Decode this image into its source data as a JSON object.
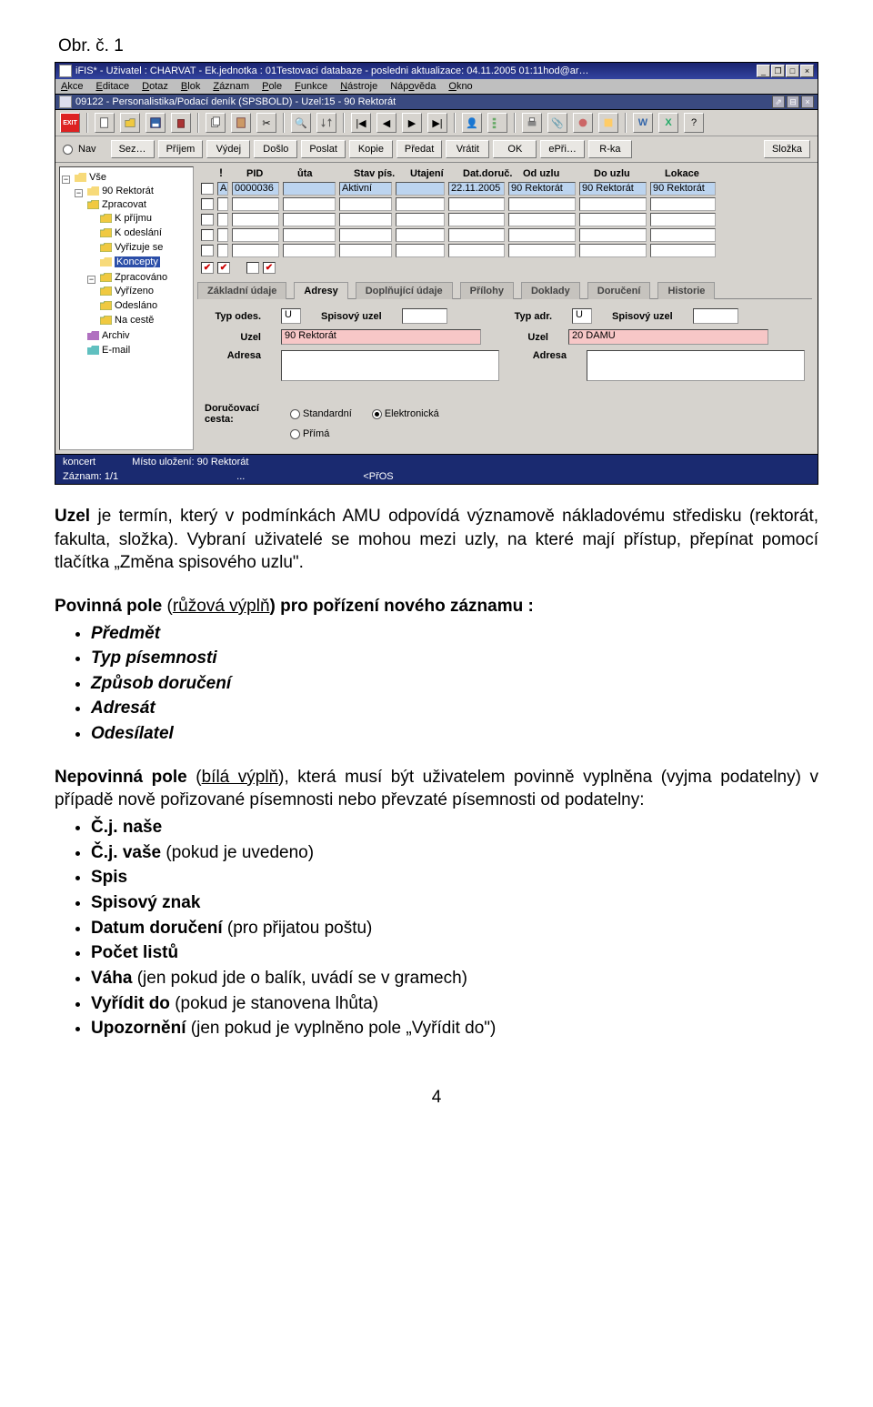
{
  "fig_label": "Obr. č. 1",
  "window": {
    "title": "iFIS* - Uživatel : CHARVAT - Ek.jednotka : 01Testovaci databaze - posledni aktualizace: 04.11.2005 01:11hod@ar…",
    "menu": [
      "Akce",
      "Editace",
      "Dotaz",
      "Blok",
      "Záznam",
      "Pole",
      "Funkce",
      "Nástroje",
      "Nápověda",
      "Okno"
    ],
    "sub_title": "09122 - Personalistika/Podací deník (SPSBOLD) - Uzel:15 - 90 Rektorát",
    "exit_label": "EXIT",
    "filter_nav": "Nav",
    "filter_tabs": [
      "Sez…",
      "Příjem",
      "Výdej",
      "Došlo",
      "Poslat",
      "Kopie",
      "Předat",
      "Vrátit",
      "OK",
      "ePři…",
      "R-ka"
    ],
    "filter_tabs_right": "Složka",
    "grid": {
      "headers": [
        "!",
        "",
        "PID",
        "ůta",
        "Stav pís.",
        "Utajení",
        "Dat.doruč.",
        "Od uzlu",
        "Do uzlu",
        "Lokace"
      ],
      "row": {
        "pid_a": "A",
        "pid": "0000036",
        "uta": "",
        "stav": "Aktivní",
        "uta2": "",
        "dat": "22.11.2005",
        "od": "90 Rektorát",
        "do_": "90 Rektorát",
        "lok": "90 Rektorát"
      }
    },
    "tree_items": {
      "vse": "Vše",
      "rekt": "90 Rektorát",
      "zpr": "Zpracovat",
      "kpr": "K příjmu",
      "kod": "K odeslání",
      "vyd": "Vyřizuje se",
      "kon": "Koncepty",
      "zpv": "Zpracováno",
      "vyr": "Vyřízeno",
      "ode": "Odesláno",
      "nac": "Na cestě",
      "arc": "Archiv",
      "ema": "E-mail"
    },
    "sub_tabs": [
      "Základní údaje",
      "Adresy",
      "Doplňující údaje",
      "Přílohy",
      "Doklady",
      "Doručení",
      "Historie"
    ],
    "form": {
      "typ_odes": "Typ odes.",
      "typ_odes_val": "U",
      "spis_uzel": "Spisový uzel",
      "typ_adr": "Typ adr.",
      "typ_adr_val": "U",
      "uzel": "Uzel",
      "uzel_l_val": "90 Rektorát",
      "uzel_r_val": "20 DAMU",
      "adresa": "Adresa",
      "dor_cesta": "Doručovací cesta:",
      "r_std": "Standardní",
      "r_ele": "Elektronická",
      "r_pri": "Přímá"
    },
    "status1": {
      "left": "koncert",
      "mid": "Místo uložení: 90 Rektorát"
    },
    "status2": {
      "left": "Záznam: 1/1",
      "mid": "...",
      "right": "<PřOS"
    }
  },
  "doc": {
    "p1a": "Uzel",
    "p1b": " je termín, který v podmínkách AMU odpovídá významově nákladovému středisku (rektorát, fakulta, složka). Vybraní uživatelé se mohou mezi uzly, na které mají přístup, přepínat pomocí tlačítka „Změna spisového uzlu\".",
    "p2a": "Povinná pole",
    "p2b": " (",
    "p2c": "růžová výplň",
    "p2d": ") pro pořízení nového záznamu :",
    "req": [
      "Předmět",
      "Typ písemnosti",
      "Způsob doručení",
      "Adresát",
      "Odesílatel"
    ],
    "p3a": "Nepovinná pole",
    "p3b": " (",
    "p3c": "bílá výplň",
    "p3d": "), která musí být uživatelem povinně vyplněna (vyjma podatelny) v případě nově pořizované písemnosti nebo převzaté písemnosti od podatelny:",
    "opt": [
      "Č.j. naše",
      "Č.j. vaše (pokud je uvedeno)",
      "Spis",
      "Spisový znak",
      "Datum doručení (pro přijatou poštu)",
      "Počet listů",
      "Váha (jen pokud jde o balík, uvádí se v gramech)",
      "Vyřídit do (pokud je stanovena lhůta)",
      "Upozornění (jen pokud je vyplněno pole „Vyřídit do\")"
    ],
    "opt_bold_idx": [
      0,
      1,
      2,
      3,
      4,
      5,
      6,
      7,
      8
    ],
    "pagenum": "4"
  }
}
